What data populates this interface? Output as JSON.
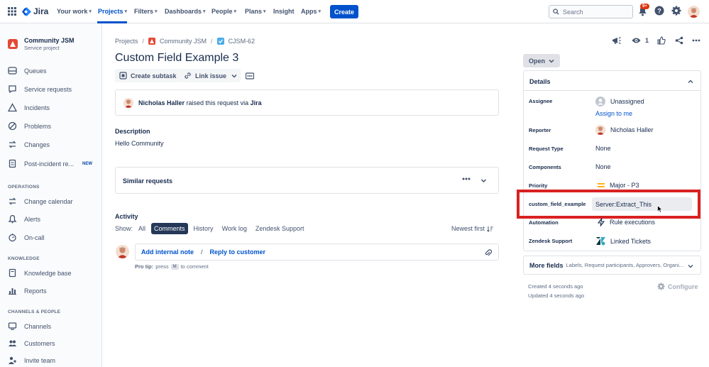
{
  "nav": {
    "logo_text": "Jira",
    "items": [
      "Your work",
      "Projects",
      "Filters",
      "Dashboards",
      "People",
      "Plans",
      "Insight",
      "Apps"
    ],
    "create_label": "Create",
    "search_placeholder": "Search",
    "notification_badge": "9+"
  },
  "sidebar": {
    "project_name": "Community JSM",
    "project_type": "Service project",
    "items_main": [
      "Queues",
      "Service requests",
      "Incidents",
      "Problems",
      "Changes",
      "Post-incident re..."
    ],
    "new_badge": "NEW",
    "operations_heading": "OPERATIONS",
    "items_operations": [
      "Change calendar",
      "Alerts",
      "On-call"
    ],
    "knowledge_heading": "KNOWLEDGE",
    "items_knowledge": [
      "Knowledge base",
      "Reports"
    ],
    "channels_heading": "CHANNELS & PEOPLE",
    "items_channels": [
      "Channels",
      "Customers",
      "Invite team"
    ]
  },
  "issue": {
    "breadcrumb": [
      "Projects",
      "Community JSM",
      "CJSM-62"
    ],
    "title": "Custom Field Example 3",
    "create_subtask": "Create subtask",
    "link_issue": "Link issue",
    "raised_by": "Nicholas Haller",
    "raised_text": "raised this request via",
    "raised_via": "Jira",
    "description_heading": "Description",
    "description": "Hello Community",
    "similar_heading": "Similar requests",
    "activity_heading": "Activity",
    "show_label": "Show:",
    "activity_tabs": [
      "All",
      "Comments",
      "History",
      "Work log",
      "Zendesk Support"
    ],
    "sort_label": "Newest first",
    "add_internal_note": "Add internal note",
    "separator": "/",
    "reply_to_customer": "Reply to customer",
    "pro_tip_prefix": "Pro tip:",
    "pro_tip_press": "press",
    "pro_tip_key": "M",
    "pro_tip_suffix": "to comment"
  },
  "right": {
    "watch_count": "1",
    "status": "Open",
    "details_heading": "Details",
    "fields": {
      "assignee_label": "Assignee",
      "assignee_value": "Unassigned",
      "assign_to_me": "Assign to me",
      "reporter_label": "Reporter",
      "reporter_value": "Nicholas Haller",
      "request_type_label": "Request Type",
      "request_type_value": "None",
      "components_label": "Components",
      "components_value": "None",
      "priority_label": "Priority",
      "priority_value": "Major - P3",
      "custom_field_label": "custom_field_example",
      "custom_field_value": "Server:Extract_This",
      "automation_label": "Automation",
      "automation_value": "Rule executions",
      "zendesk_label": "Zendesk Support",
      "zendesk_value": "Linked Tickets"
    },
    "more_fields_label": "More fields",
    "more_fields_hint": "Labels, Request participants, Approvers, Organi...",
    "created": "Created 4 seconds ago",
    "updated": "Updated 4 seconds ago",
    "configure": "Configure"
  },
  "colors": {
    "accent": "#0052cc",
    "highlight": "#d92121",
    "priority": "#ffab00"
  }
}
